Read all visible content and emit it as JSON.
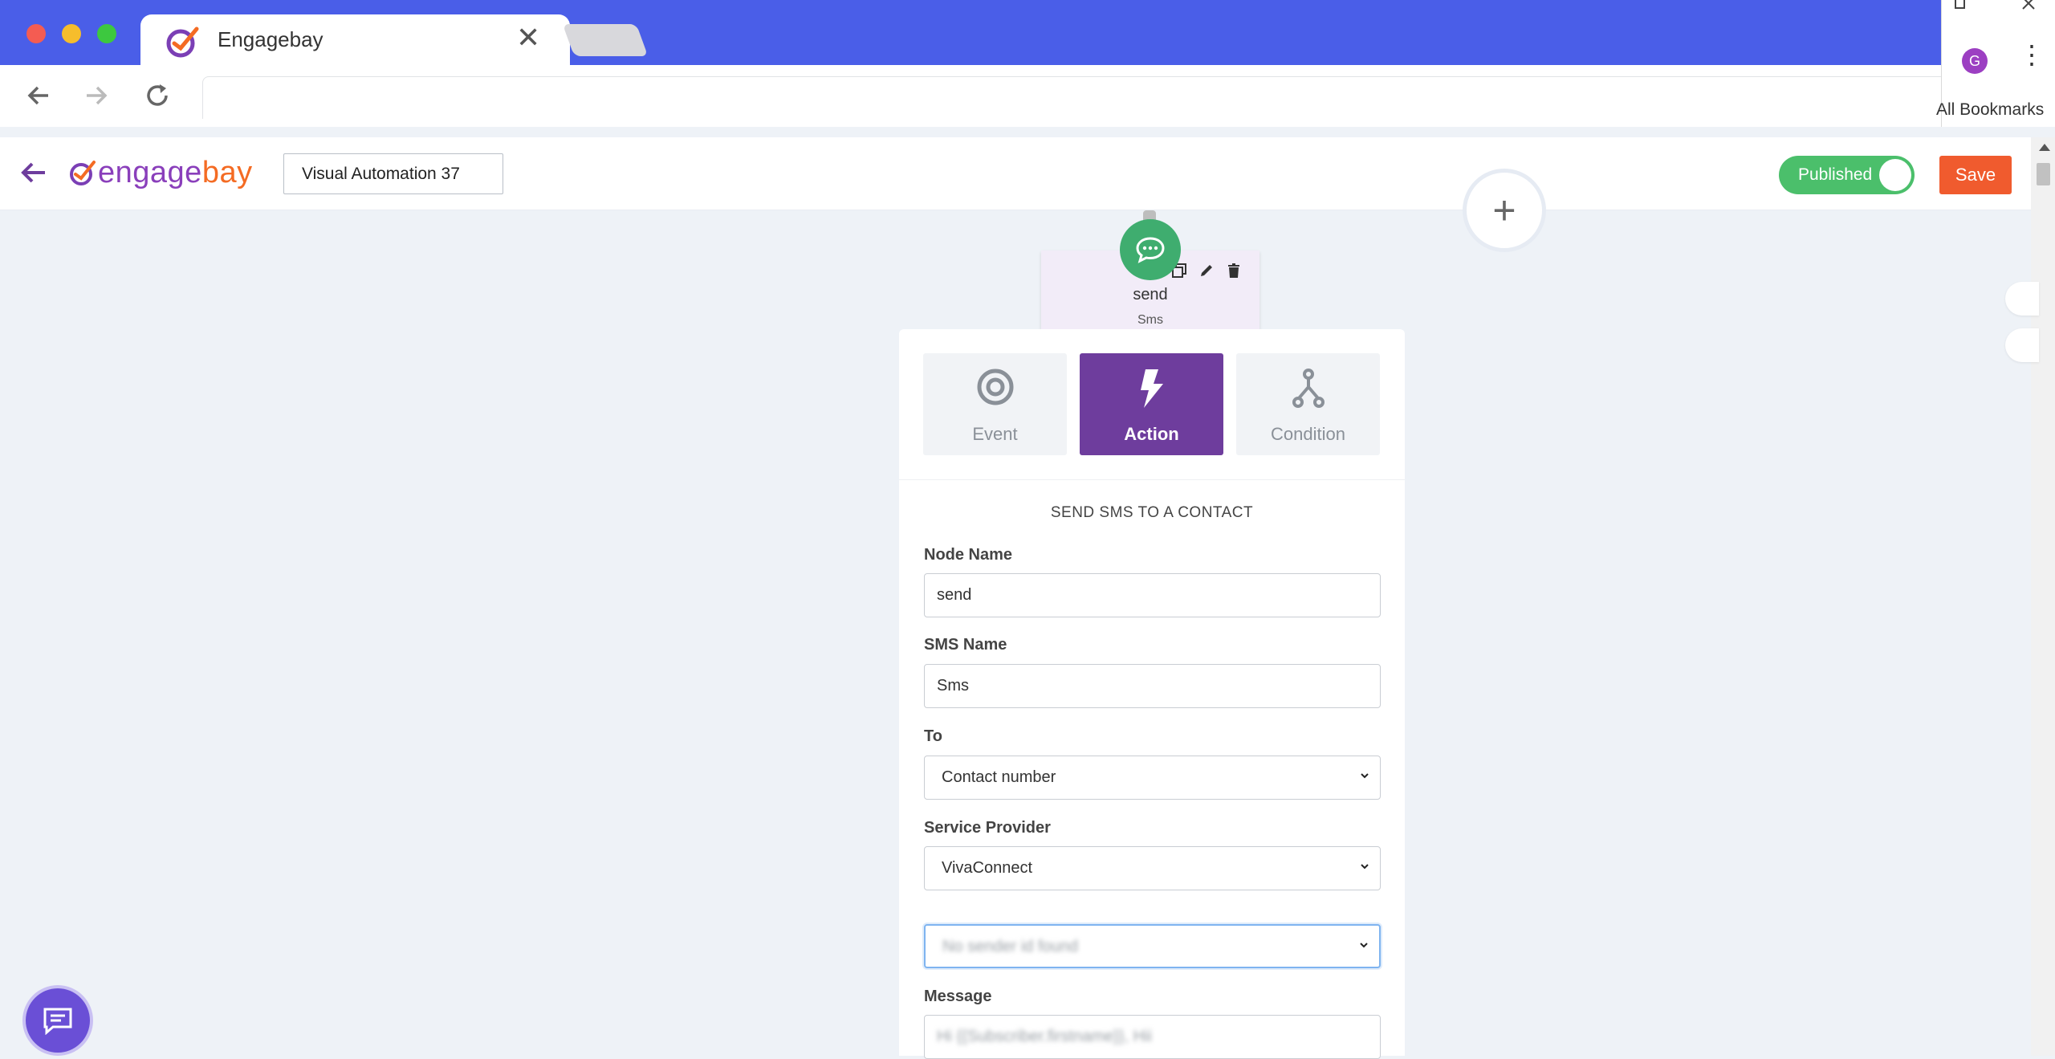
{
  "browser": {
    "tab_title": "Engagebay",
    "tab_close": "✕",
    "profile_initial": "G",
    "bookmarks_label": "All Bookmarks"
  },
  "header": {
    "brand_prefix": "engage",
    "brand_suffix": "bay",
    "automation_name": "Visual Automation 37",
    "published_label": "Published",
    "published_on": true,
    "save_label": "Save"
  },
  "canvas": {
    "node_title": "send",
    "node_subtitle": "Sms",
    "add_symbol": "+"
  },
  "panel": {
    "tabs": [
      {
        "label": "Event",
        "icon": "target-icon",
        "active": false
      },
      {
        "label": "Action",
        "icon": "lightning-icon",
        "active": true
      },
      {
        "label": "Condition",
        "icon": "branch-icon",
        "active": false
      }
    ],
    "section_title": "SEND SMS TO A CONTACT",
    "fields": {
      "node_name_label": "Node Name",
      "node_name_value": "send",
      "sms_name_label": "SMS Name",
      "sms_name_value": "Sms",
      "to_label": "To",
      "to_value": "Contact number",
      "provider_label": "Service Provider",
      "provider_value": "VivaConnect",
      "sender_value": "No sender id found",
      "message_label": "Message",
      "message_value": "Hi {{Subscriber.firstname}}, Hii"
    }
  },
  "colors": {
    "tabbar": "#4a5ee8",
    "accent_purple": "#6e3d9d",
    "published_green": "#4bbf6b",
    "save_orange": "#f05b2e",
    "node_green": "#3fad6f"
  }
}
